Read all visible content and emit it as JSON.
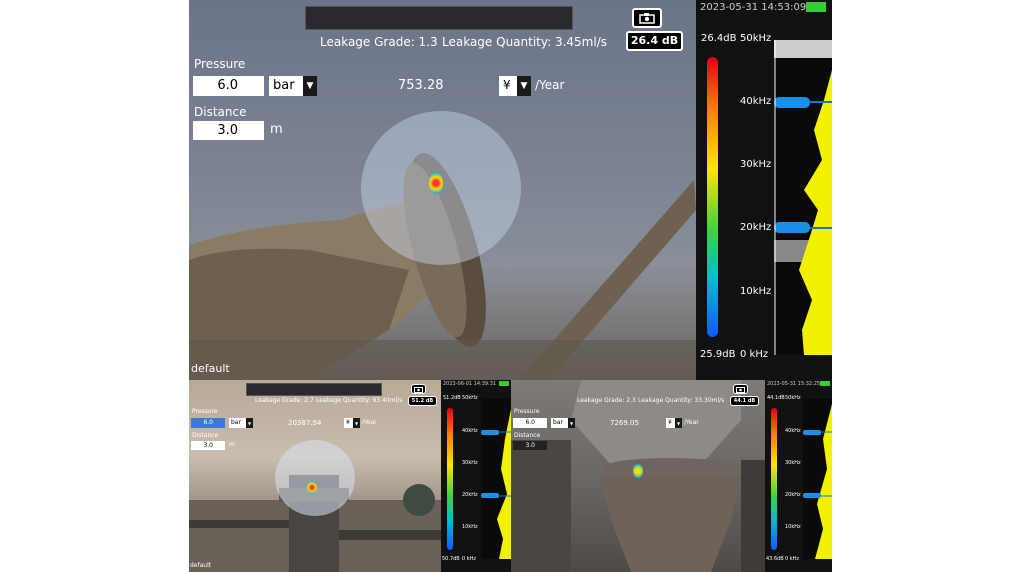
{
  "main": {
    "leakage_grade": "Leakage Grade: 1.3",
    "leakage_quantity": "Leakage Quantity: 3.45ml/s",
    "db_badge": "26.4 dB",
    "pressure_label": "Pressure",
    "pressure_value": "6.0",
    "pressure_unit": "bar",
    "cost_value": "753.28",
    "currency": "¥",
    "per_year": "/Year",
    "distance_label": "Distance",
    "distance_value": "3.0",
    "distance_unit": "m",
    "profile": "default",
    "timestamp": "2023-05-31 14:53:09",
    "scale_max": "26.4dB",
    "scale_min": "25.9dB",
    "freq_top": "50kHz",
    "freq_40": "40kHz",
    "freq_30": "30kHz",
    "freq_20": "20kHz",
    "freq_10": "10kHz",
    "freq_0": "0 kHz"
  },
  "left": {
    "leakage_grade": "Leakage Grade: 2.7",
    "leakage_quantity": "Leakage Quantity: 93.40ml/s",
    "db_badge": "51.2 dB",
    "pressure_label": "Pressure",
    "pressure_value": "6.0",
    "pressure_unit": "bar",
    "cost_value": "20387.94",
    "currency": "¥",
    "per_year": "/Year",
    "distance_label": "Distance",
    "distance_value": "3.0",
    "distance_unit": "m",
    "profile": "default",
    "timestamp": "2023-06-01 14:39:31",
    "scale_max": "51.2dB",
    "scale_min": "50.7dB",
    "freq_top": "50kHz",
    "freq_40": "40kHz",
    "freq_30": "30kHz",
    "freq_20": "20kHz",
    "freq_10": "10kHz",
    "freq_0": "0 kHz"
  },
  "right": {
    "leakage_grade": "Leakage Grade: 2.3",
    "leakage_quantity": "Leakage Quantity: 33.30ml/s",
    "db_badge": "44.1 dB",
    "pressure_label": "Pressure",
    "pressure_value": "6.0",
    "pressure_unit": "bar",
    "cost_value": "7269.05",
    "currency": "¥",
    "per_year": "/Year",
    "distance_label": "Distance",
    "distance_value": "3.0",
    "timestamp": "2023-05-31 15:32:25",
    "scale_max": "44.1dB",
    "scale_min": "43.6dB",
    "freq_top": "50kHz",
    "freq_40": "40kHz",
    "freq_30": "30kHz",
    "freq_20": "20kHz",
    "freq_10": "10kHz",
    "freq_0": "0 kHz"
  }
}
